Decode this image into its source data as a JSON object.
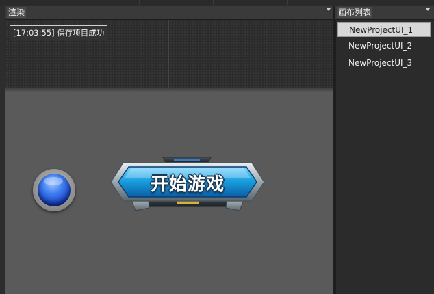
{
  "render_panel": {
    "title": "渲染",
    "status_message": "[17:03:55]  保存项目成功",
    "start_button_label": "开始游戏"
  },
  "canvas_panel": {
    "title": "画布列表",
    "items": [
      {
        "label": "NewProjectUI_1",
        "selected": true
      },
      {
        "label": "NewProjectUI_2",
        "selected": false
      },
      {
        "label": "NewProjectUI_3",
        "selected": false
      }
    ]
  },
  "colors": {
    "background": "#2d2d2d",
    "render_area": "#5a5a5a",
    "button_blue": "#1a9ad6",
    "orb_blue": "#2f63e0"
  },
  "icons": [
    "dropdown-arrow-icon",
    "blue-orb-icon"
  ]
}
